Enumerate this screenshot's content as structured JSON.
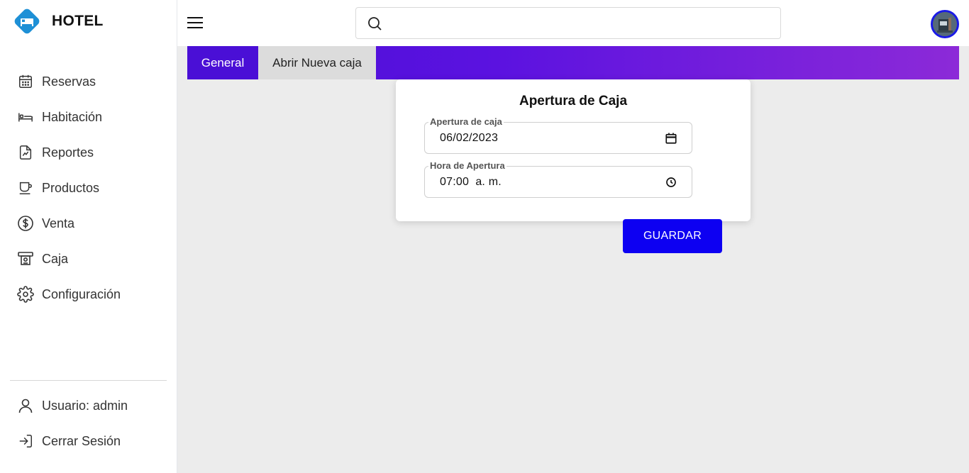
{
  "brand": {
    "title": "HOTEL",
    "logo_color": "#1e90d6"
  },
  "sidebar": {
    "items": [
      {
        "label": "Reservas",
        "icon": "calendar-icon"
      },
      {
        "label": "Habitación",
        "icon": "bed-icon"
      },
      {
        "label": "Reportes",
        "icon": "report-icon"
      },
      {
        "label": "Productos",
        "icon": "cup-icon"
      },
      {
        "label": "Venta",
        "icon": "dollar-icon"
      },
      {
        "label": "Caja",
        "icon": "cash-register-icon"
      },
      {
        "label": "Configuración",
        "icon": "gear-icon"
      }
    ],
    "bottom": [
      {
        "label": "Usuario: admin",
        "icon": "user-icon"
      },
      {
        "label": "Cerrar Sesión",
        "icon": "logout-icon"
      }
    ]
  },
  "header": {
    "search_placeholder": "",
    "search_value": ""
  },
  "tabs": [
    {
      "label": "General",
      "active": true
    },
    {
      "label": "Abrir Nueva caja",
      "active": false
    }
  ],
  "form": {
    "title": "Apertura de Caja",
    "date_field": {
      "label": "Apertura de caja",
      "value": "06/02/2023"
    },
    "time_field": {
      "label": "Hora de Apertura",
      "value": "07:00  a. m."
    },
    "save_label": "GUARDAR"
  },
  "colors": {
    "accent": "#0d00f2",
    "tab_gradient_start": "#4a0fd6",
    "tab_gradient_end": "#8c2ad8",
    "background": "#ececec"
  }
}
